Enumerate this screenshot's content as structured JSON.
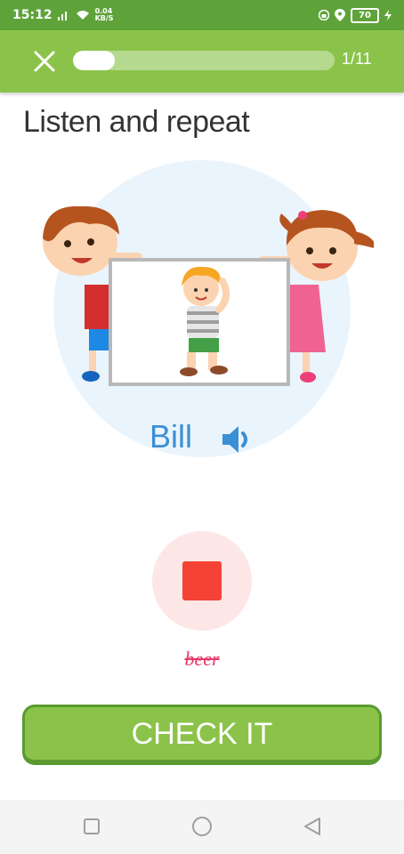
{
  "status_bar": {
    "time": "15:12",
    "speed_value": "0.04",
    "speed_unit": "KB/S",
    "battery": "70"
  },
  "header": {
    "progress_fraction": 0.16,
    "counter": "1/11"
  },
  "lesson": {
    "title": "Listen and repeat",
    "word": "Bill",
    "recognized": "beer"
  },
  "check_label": "CHECK IT",
  "colors": {
    "status_bar": "#5ea33a",
    "header": "#8bc34a",
    "accent_green": "#8bc34a",
    "word_blue": "#3b8fd4",
    "stop_red": "#f44336",
    "recognized_pink": "#e53967"
  },
  "icons": [
    "close-icon",
    "speaker-icon",
    "stop-icon",
    "square-icon",
    "circle-icon",
    "back-triangle-icon"
  ]
}
